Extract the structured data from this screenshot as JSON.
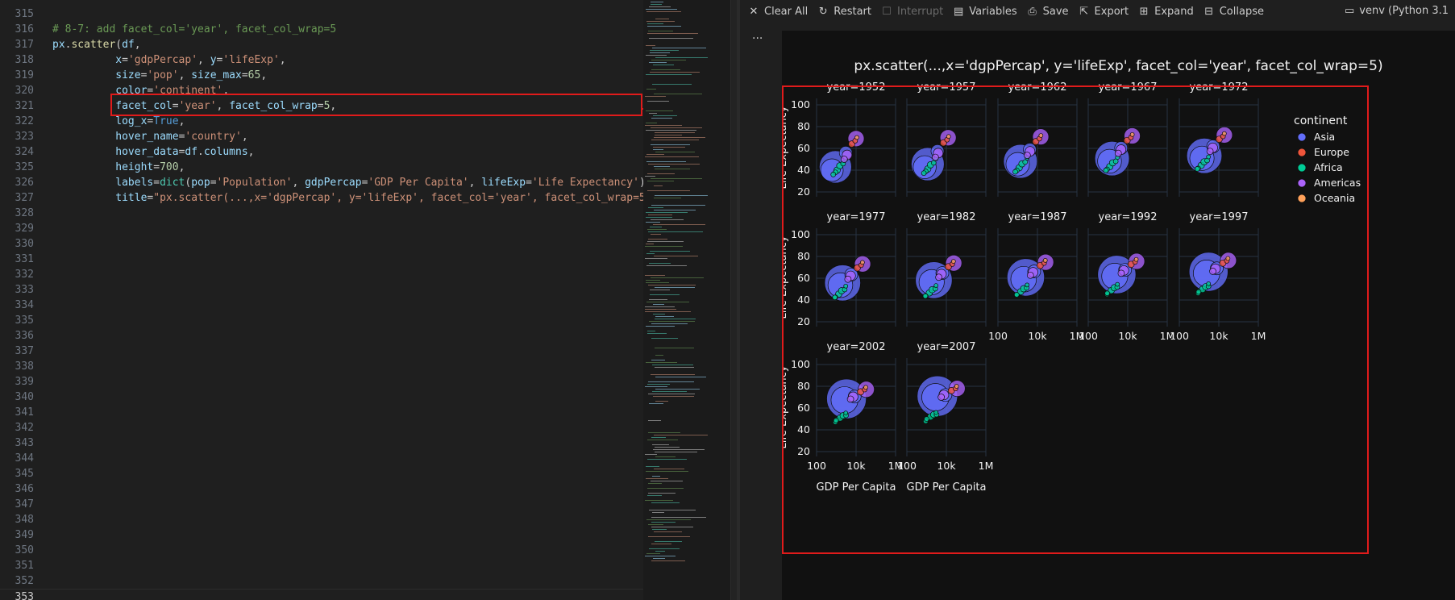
{
  "editor": {
    "lines": [
      {
        "n": "315",
        "tokens": []
      },
      {
        "n": "316",
        "tokens": [
          [
            "# 8-7: add facet_col='year', facet_col_wrap=5",
            "c-com"
          ]
        ]
      },
      {
        "n": "317",
        "tokens": [
          [
            "px",
            "c-var"
          ],
          [
            ".",
            "c-pl"
          ],
          [
            "scatter",
            "c-fn"
          ],
          [
            "(",
            "c-pl"
          ],
          [
            "df",
            "c-var"
          ],
          [
            ",",
            "c-pl"
          ]
        ]
      },
      {
        "n": "318",
        "tokens": [
          [
            "          ",
            "c-pl"
          ],
          [
            "x",
            "c-var"
          ],
          [
            "=",
            "c-pl"
          ],
          [
            "'gdpPercap'",
            "c-str"
          ],
          [
            ", ",
            "c-pl"
          ],
          [
            "y",
            "c-var"
          ],
          [
            "=",
            "c-pl"
          ],
          [
            "'lifeExp'",
            "c-str"
          ],
          [
            ",",
            "c-pl"
          ]
        ]
      },
      {
        "n": "319",
        "tokens": [
          [
            "          ",
            "c-pl"
          ],
          [
            "size",
            "c-var"
          ],
          [
            "=",
            "c-pl"
          ],
          [
            "'pop'",
            "c-str"
          ],
          [
            ", ",
            "c-pl"
          ],
          [
            "size_max",
            "c-var"
          ],
          [
            "=",
            "c-pl"
          ],
          [
            "65",
            "c-num"
          ],
          [
            ",",
            "c-pl"
          ]
        ]
      },
      {
        "n": "320",
        "tokens": [
          [
            "          ",
            "c-pl"
          ],
          [
            "color",
            "c-var"
          ],
          [
            "=",
            "c-pl"
          ],
          [
            "'continent'",
            "c-str"
          ],
          [
            ",",
            "c-pl"
          ]
        ]
      },
      {
        "n": "321",
        "tokens": [
          [
            "          ",
            "c-pl"
          ],
          [
            "facet_col",
            "c-var"
          ],
          [
            "=",
            "c-pl"
          ],
          [
            "'year'",
            "c-str"
          ],
          [
            ", ",
            "c-pl"
          ],
          [
            "facet_col_wrap",
            "c-var"
          ],
          [
            "=",
            "c-pl"
          ],
          [
            "5",
            "c-num"
          ],
          [
            ",",
            "c-pl"
          ]
        ]
      },
      {
        "n": "322",
        "tokens": [
          [
            "          ",
            "c-pl"
          ],
          [
            "log_x",
            "c-var"
          ],
          [
            "=",
            "c-pl"
          ],
          [
            "True",
            "c-kw"
          ],
          [
            ",",
            "c-pl"
          ]
        ]
      },
      {
        "n": "323",
        "tokens": [
          [
            "          ",
            "c-pl"
          ],
          [
            "hover_name",
            "c-var"
          ],
          [
            "=",
            "c-pl"
          ],
          [
            "'country'",
            "c-str"
          ],
          [
            ",",
            "c-pl"
          ]
        ]
      },
      {
        "n": "324",
        "tokens": [
          [
            "          ",
            "c-pl"
          ],
          [
            "hover_data",
            "c-var"
          ],
          [
            "=",
            "c-pl"
          ],
          [
            "df",
            "c-var"
          ],
          [
            ".",
            "c-pl"
          ],
          [
            "columns",
            "c-var"
          ],
          [
            ",",
            "c-pl"
          ]
        ]
      },
      {
        "n": "325",
        "tokens": [
          [
            "          ",
            "c-pl"
          ],
          [
            "height",
            "c-var"
          ],
          [
            "=",
            "c-pl"
          ],
          [
            "700",
            "c-num"
          ],
          [
            ",",
            "c-pl"
          ]
        ]
      },
      {
        "n": "326",
        "tokens": [
          [
            "          ",
            "c-pl"
          ],
          [
            "labels",
            "c-var"
          ],
          [
            "=",
            "c-pl"
          ],
          [
            "dict",
            "c-ty"
          ],
          [
            "(",
            "c-pl"
          ],
          [
            "pop",
            "c-var"
          ],
          [
            "=",
            "c-pl"
          ],
          [
            "'Population'",
            "c-str"
          ],
          [
            ", ",
            "c-pl"
          ],
          [
            "gdpPercap",
            "c-var"
          ],
          [
            "=",
            "c-pl"
          ],
          [
            "'GDP Per Capita'",
            "c-str"
          ],
          [
            ", ",
            "c-pl"
          ],
          [
            "lifeExp",
            "c-var"
          ],
          [
            "=",
            "c-pl"
          ],
          [
            "'Life Expectancy'",
            "c-str"
          ],
          [
            ")",
            "c-pl"
          ]
        ]
      },
      {
        "n": "327",
        "tokens": [
          [
            "          ",
            "c-pl"
          ],
          [
            "title",
            "c-var"
          ],
          [
            "=",
            "c-pl"
          ],
          [
            "\"px.scatter(...,x='dgpPercap', y='lifeExp', facet_col='year', facet_col_wrap=5",
            "c-str"
          ]
        ]
      },
      {
        "n": "328",
        "tokens": []
      },
      {
        "n": "329",
        "tokens": []
      },
      {
        "n": "330",
        "tokens": []
      },
      {
        "n": "331",
        "tokens": []
      },
      {
        "n": "332",
        "tokens": []
      },
      {
        "n": "333",
        "tokens": []
      },
      {
        "n": "334",
        "tokens": []
      },
      {
        "n": "335",
        "tokens": []
      },
      {
        "n": "336",
        "tokens": []
      },
      {
        "n": "337",
        "tokens": []
      },
      {
        "n": "338",
        "tokens": []
      },
      {
        "n": "339",
        "tokens": []
      },
      {
        "n": "340",
        "tokens": []
      },
      {
        "n": "341",
        "tokens": []
      },
      {
        "n": "342",
        "tokens": []
      },
      {
        "n": "343",
        "tokens": []
      },
      {
        "n": "344",
        "tokens": []
      },
      {
        "n": "345",
        "tokens": []
      },
      {
        "n": "346",
        "tokens": []
      },
      {
        "n": "347",
        "tokens": []
      },
      {
        "n": "348",
        "tokens": []
      },
      {
        "n": "349",
        "tokens": []
      },
      {
        "n": "350",
        "tokens": []
      },
      {
        "n": "351",
        "tokens": []
      },
      {
        "n": "352",
        "tokens": []
      },
      {
        "n": "353",
        "tokens": []
      }
    ]
  },
  "toolbar": {
    "clear_all": "Clear All",
    "restart": "Restart",
    "interrupt": "Interrupt",
    "variables": "Variables",
    "save": "Save",
    "export": "Export",
    "expand": "Expand",
    "collapse": "Collapse",
    "kernel": "venv (Python 3.1",
    "ellipsis": "..."
  },
  "chart_data": {
    "type": "scatter",
    "title": "px.scatter(...,x='dgpPercap', y='lifeExp', facet_col='year', facet_col_wrap=5)",
    "xlabel": "GDP Per Capita",
    "ylabel": "Life Expectancy",
    "x_scale": "log",
    "xlim": [
      100,
      1000000
    ],
    "ylim": [
      20,
      100
    ],
    "x_ticks": [
      "100",
      "10k",
      "1M"
    ],
    "y_ticks": [
      "100",
      "80",
      "60",
      "40",
      "20"
    ],
    "facets": [
      "year=1952",
      "year=1957",
      "year=1962",
      "year=1967",
      "year=1972",
      "year=1977",
      "year=1982",
      "year=1987",
      "year=1992",
      "year=1997",
      "year=2002",
      "year=2007"
    ],
    "legend_title": "continent",
    "legend_position": "right",
    "grid": true,
    "series": [
      {
        "name": "Asia",
        "color": "#636efa"
      },
      {
        "name": "Europe",
        "color": "#ef553b"
      },
      {
        "name": "Africa",
        "color": "#00cc96"
      },
      {
        "name": "Americas",
        "color": "#ab63fa"
      },
      {
        "name": "Oceania",
        "color": "#ffa15a"
      }
    ]
  }
}
